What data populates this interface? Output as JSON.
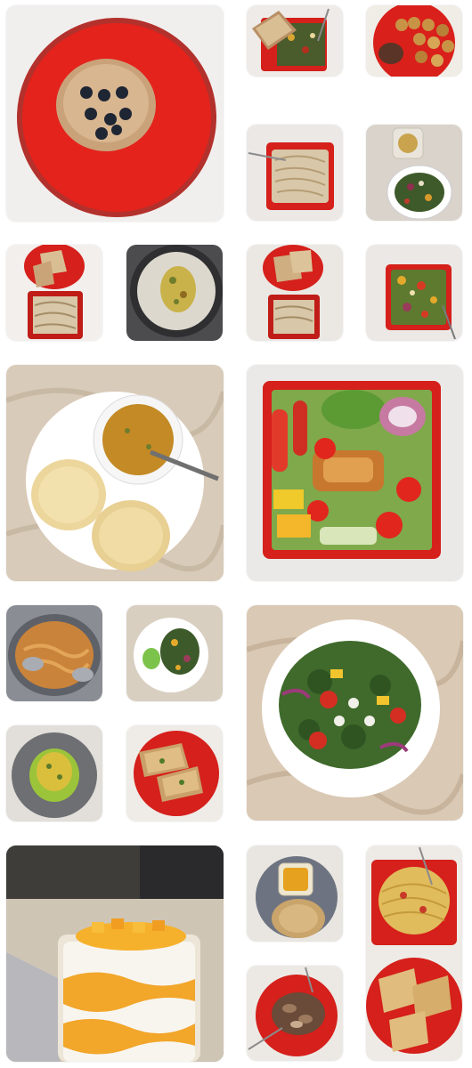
{
  "gallery": {
    "photos": [
      {
        "name": "pancakes-with-blueberries-photo"
      },
      {
        "name": "toast-and-vegetable-stirfry-photo"
      },
      {
        "name": "fried-bites-with-chutney-photo"
      },
      {
        "name": "noodles-on-red-plate-photo"
      },
      {
        "name": "dressing-and-vegetable-salad-photo"
      },
      {
        "name": "toast-and-noodles-two-plates-photo"
      },
      {
        "name": "dosa-with-filling-on-pan-photo"
      },
      {
        "name": "toast-and-noodles-stacked-photo"
      },
      {
        "name": "chopped-vegetable-salad-photo"
      },
      {
        "name": "chole-bhature-photo"
      },
      {
        "name": "chicken-garden-salad-photo"
      },
      {
        "name": "poha-in-pan-photo"
      },
      {
        "name": "green-salad-with-chutney-photo"
      },
      {
        "name": "broccoli-feta-salad-photo"
      },
      {
        "name": "upma-mound-photo"
      },
      {
        "name": "garlic-toast-photo"
      },
      {
        "name": "mango-parfait-photo"
      },
      {
        "name": "dal-and-paratha-photo"
      },
      {
        "name": "spaghetti-and-garlic-bread-photo"
      },
      {
        "name": "mushroom-stirfry-photo"
      }
    ]
  }
}
